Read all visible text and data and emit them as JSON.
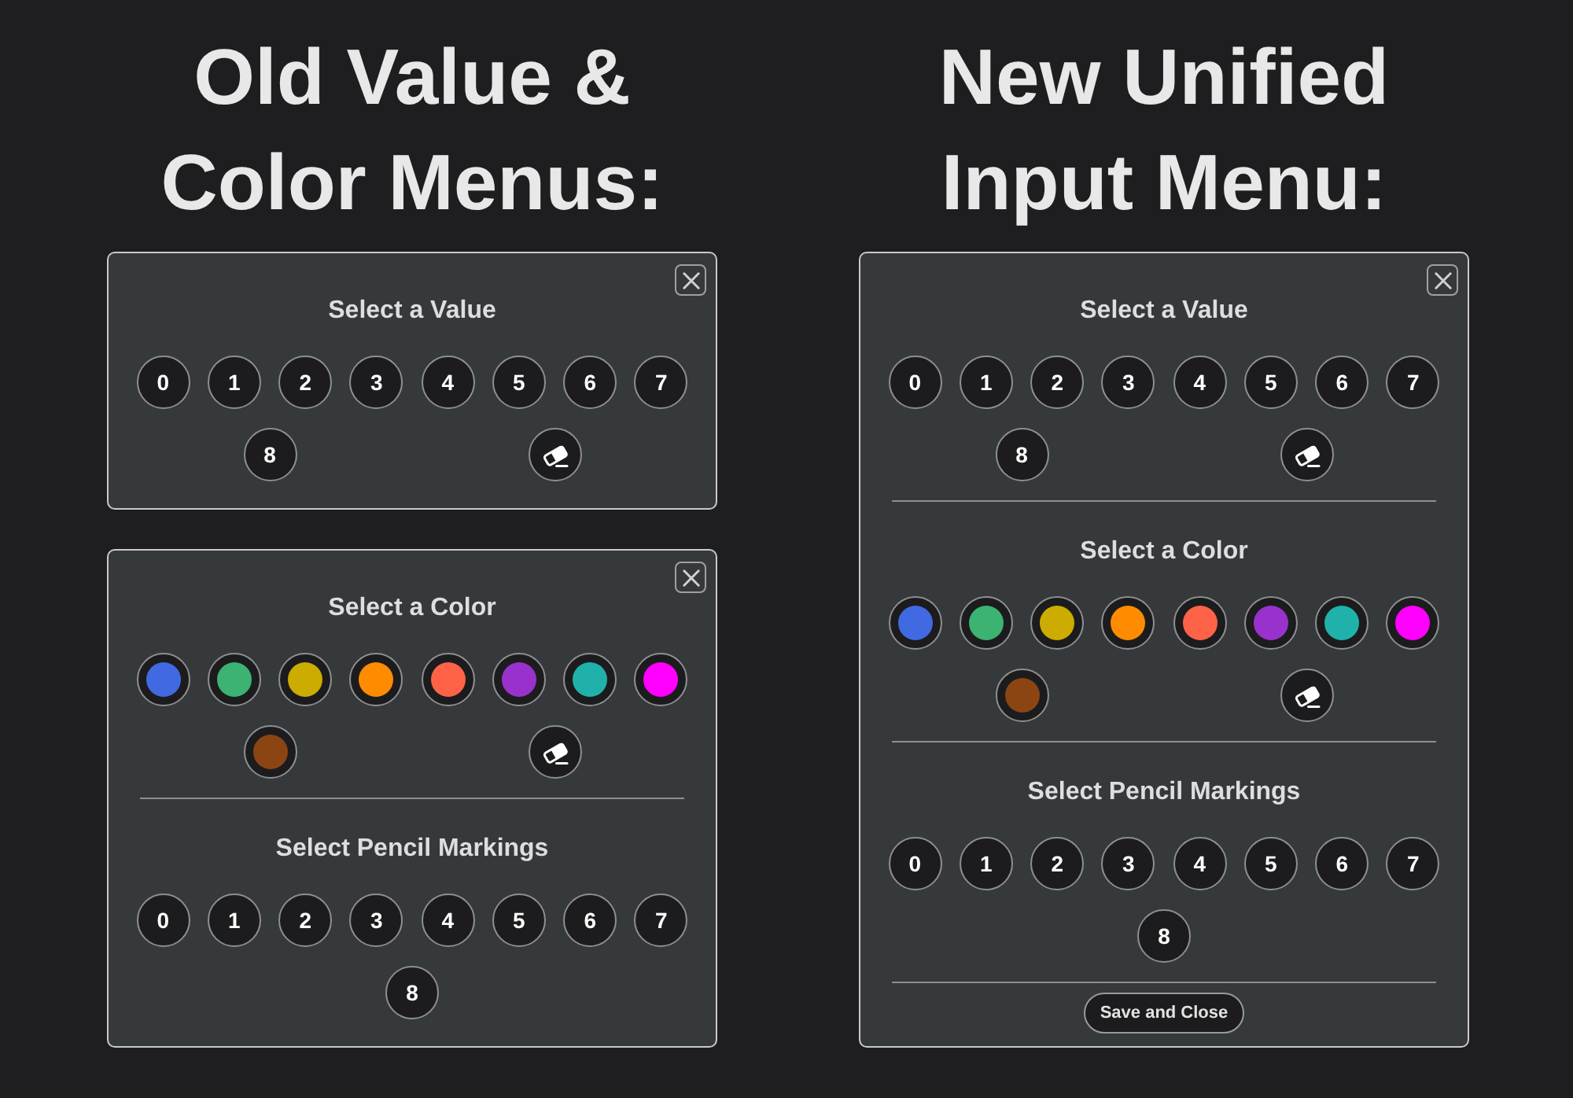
{
  "columns": [
    {
      "heading": "Old Value & Color Menus:",
      "panels": [
        {
          "sections": [
            {
              "title": "Select a Value",
              "items": [
                {
                  "kind": "number",
                  "label": "0"
                },
                {
                  "kind": "number",
                  "label": "1"
                },
                {
                  "kind": "number",
                  "label": "2"
                },
                {
                  "kind": "number",
                  "label": "3"
                },
                {
                  "kind": "number",
                  "label": "4"
                },
                {
                  "kind": "number",
                  "label": "5"
                },
                {
                  "kind": "number",
                  "label": "6"
                },
                {
                  "kind": "number",
                  "label": "7"
                },
                {
                  "kind": "number",
                  "label": "8"
                },
                {
                  "kind": "eraser"
                }
              ]
            }
          ]
        },
        {
          "sections": [
            {
              "title": "Select a Color",
              "items": [
                {
                  "kind": "swatch",
                  "color": "#4169e1"
                },
                {
                  "kind": "swatch",
                  "color": "#3cb371"
                },
                {
                  "kind": "swatch",
                  "color": "#ccac00"
                },
                {
                  "kind": "swatch",
                  "color": "#ff8c00"
                },
                {
                  "kind": "swatch",
                  "color": "#ff6347"
                },
                {
                  "kind": "swatch",
                  "color": "#9932cc"
                },
                {
                  "kind": "swatch",
                  "color": "#20b2aa"
                },
                {
                  "kind": "swatch",
                  "color": "#ff00ff"
                },
                {
                  "kind": "swatch",
                  "color": "#8b4513"
                },
                {
                  "kind": "eraser"
                }
              ]
            },
            {
              "title": "Select Pencil Markings",
              "items": [
                {
                  "kind": "number",
                  "label": "0"
                },
                {
                  "kind": "number",
                  "label": "1"
                },
                {
                  "kind": "number",
                  "label": "2"
                },
                {
                  "kind": "number",
                  "label": "3"
                },
                {
                  "kind": "number",
                  "label": "4"
                },
                {
                  "kind": "number",
                  "label": "5"
                },
                {
                  "kind": "number",
                  "label": "6"
                },
                {
                  "kind": "number",
                  "label": "7"
                },
                {
                  "kind": "number",
                  "label": "8"
                }
              ]
            }
          ]
        }
      ]
    },
    {
      "heading": "New Unified Input Menu:",
      "panels": [
        {
          "sections": [
            {
              "title": "Select a Value",
              "items": [
                {
                  "kind": "number",
                  "label": "0"
                },
                {
                  "kind": "number",
                  "label": "1"
                },
                {
                  "kind": "number",
                  "label": "2"
                },
                {
                  "kind": "number",
                  "label": "3"
                },
                {
                  "kind": "number",
                  "label": "4"
                },
                {
                  "kind": "number",
                  "label": "5"
                },
                {
                  "kind": "number",
                  "label": "6"
                },
                {
                  "kind": "number",
                  "label": "7"
                },
                {
                  "kind": "number",
                  "label": "8"
                },
                {
                  "kind": "eraser"
                }
              ]
            },
            {
              "title": "Select a Color",
              "items": [
                {
                  "kind": "swatch",
                  "color": "#4169e1"
                },
                {
                  "kind": "swatch",
                  "color": "#3cb371"
                },
                {
                  "kind": "swatch",
                  "color": "#ccac00"
                },
                {
                  "kind": "swatch",
                  "color": "#ff8c00"
                },
                {
                  "kind": "swatch",
                  "color": "#ff6347"
                },
                {
                  "kind": "swatch",
                  "color": "#9932cc"
                },
                {
                  "kind": "swatch",
                  "color": "#20b2aa"
                },
                {
                  "kind": "swatch",
                  "color": "#ff00ff"
                },
                {
                  "kind": "swatch",
                  "color": "#8b4513"
                },
                {
                  "kind": "eraser"
                }
              ]
            },
            {
              "title": "Select Pencil Markings",
              "items": [
                {
                  "kind": "number",
                  "label": "0"
                },
                {
                  "kind": "number",
                  "label": "1"
                },
                {
                  "kind": "number",
                  "label": "2"
                },
                {
                  "kind": "number",
                  "label": "3"
                },
                {
                  "kind": "number",
                  "label": "4"
                },
                {
                  "kind": "number",
                  "label": "5"
                },
                {
                  "kind": "number",
                  "label": "6"
                },
                {
                  "kind": "number",
                  "label": "7"
                },
                {
                  "kind": "number",
                  "label": "8"
                }
              ]
            }
          ],
          "footer_button": "Save and Close"
        }
      ]
    }
  ]
}
